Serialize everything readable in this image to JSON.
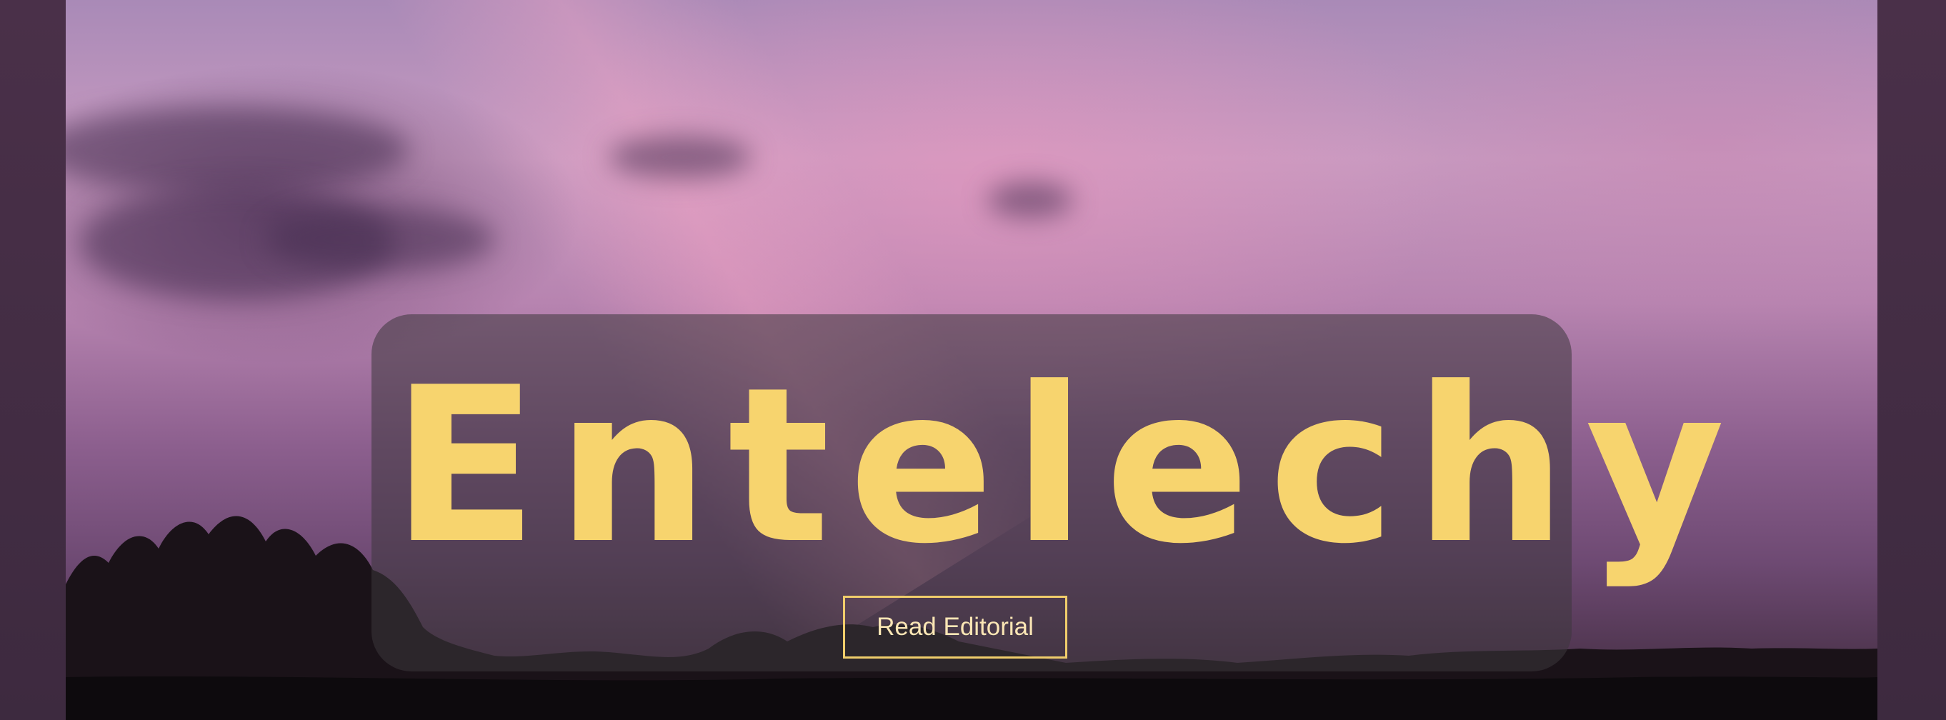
{
  "hero": {
    "title": "Entelechy",
    "cta_label": "Read Editorial"
  },
  "colors": {
    "title": "#f7d46e",
    "button_border": "#f0cd6b",
    "side_bars": "#3f2a42"
  }
}
